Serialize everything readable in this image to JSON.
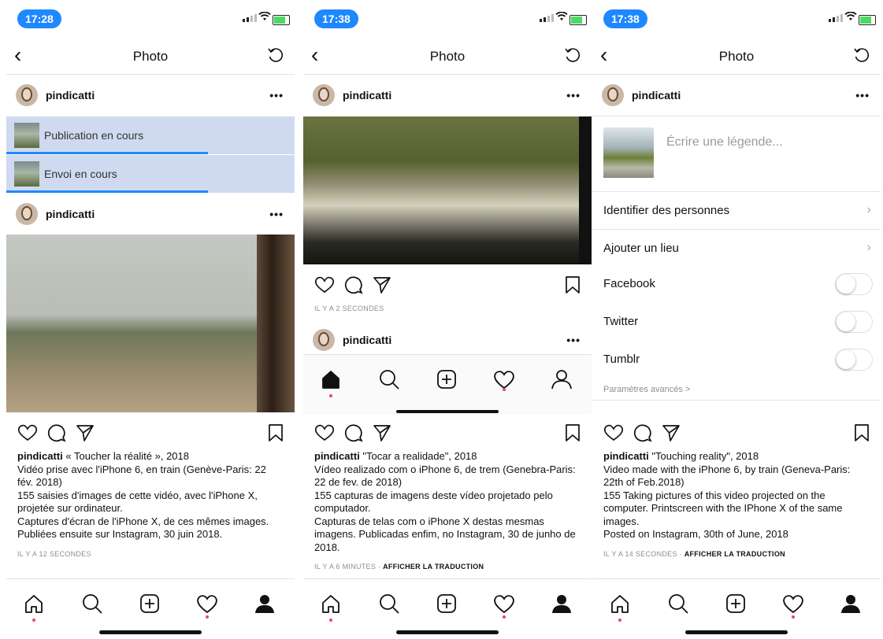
{
  "panels": [
    {
      "status_time": "17:28",
      "nav_title": "Photo",
      "user": "pindicatti",
      "more": "•••",
      "uploads": [
        {
          "label": "Publication en cours",
          "progress": 0.7
        },
        {
          "label": "Envoi en cours",
          "progress": 0.7
        }
      ],
      "post_user": "pindicatti",
      "caption_title": "« Toucher la réalité », 2018",
      "caption_lines": [
        "Vidéo prise avec l'iPhone 6, en train (Genève-Paris: 22 fév. 2018)",
        "155 saisies d'images de cette vidéo, avec l'iPhone X, projetée sur ordinateur.",
        "Captures d'écran de l'iPhone X, de ces mêmes images. Publiées ensuite sur Instagram, 30 juin 2018."
      ],
      "time_ago": "IL Y A 12 SECONDES",
      "translate": ""
    },
    {
      "status_time": "17:38",
      "nav_title": "Photo",
      "user": "pindicatti",
      "more": "•••",
      "post_time_ago": "IL Y A 2 SECONDES",
      "next_user": "pindicatti",
      "caption_title": "\"Tocar a realidade\", 2018",
      "caption_lines": [
        "Vídeo realizado com o iPhone 6, de trem (Genebra-Paris: 22 de fev. de 2018)",
        "155 capturas de imagens deste vídeo projetado pelo computador.",
        "Capturas de telas com o iPhone X destas mesmas imagens. Publicadas enfim, no Instagram, 30 de junho de 2018."
      ],
      "time_ago": "IL Y A 6 MINUTES",
      "translate": "AFFICHER LA TRADUCTION"
    },
    {
      "status_time": "17:38",
      "nav_title": "Photo",
      "user": "pindicatti",
      "more": "•••",
      "caption_placeholder": "Écrire une légende...",
      "rows": [
        {
          "label": "Identifier des personnes",
          "chevron": "›"
        },
        {
          "label": "Ajouter un lieu",
          "chevron": "›"
        }
      ],
      "toggles": [
        {
          "label": "Facebook",
          "on": false
        },
        {
          "label": "Twitter",
          "on": false
        },
        {
          "label": "Tumblr",
          "on": false
        }
      ],
      "advanced": "Paramètres avancés >",
      "caption_title": "\"Touching reality\", 2018",
      "caption_lines": [
        "Video made with the iPhone 6, by train (Geneva-Paris: 22th of Feb.2018)",
        "155 Taking pictures of this video projected on the computer. Printscreen with the IPhone X of the same images.",
        "Posted on Instagram, 30th of June, 2018"
      ],
      "time_ago": "IL Y A 14 SECONDES",
      "translate": "AFFICHER LA TRADUCTION"
    }
  ],
  "icons": {
    "back": "‹",
    "separator": " · "
  },
  "colors": {
    "accent": "#1e88ff",
    "upload_bg": "#cfdaf0",
    "notification_dot": "#ed4956"
  }
}
